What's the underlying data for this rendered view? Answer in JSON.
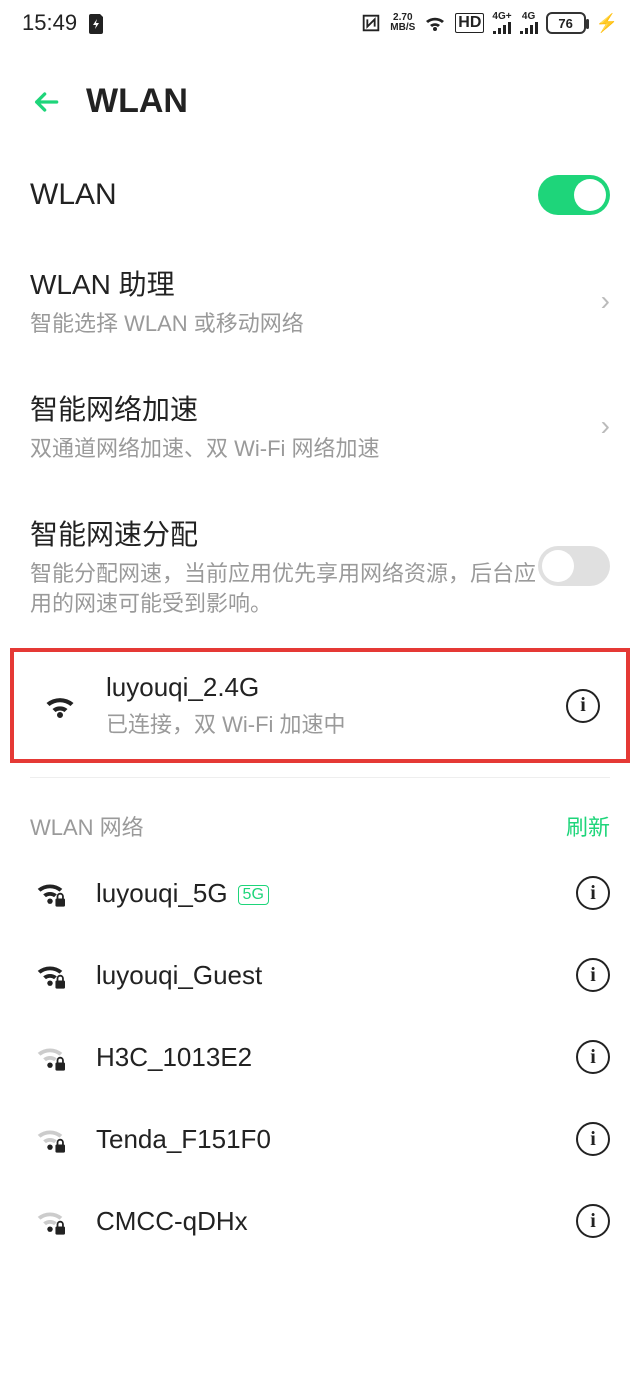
{
  "status": {
    "time": "15:49",
    "speed_top": "2.70",
    "speed_bot": "MB/S",
    "hd": "HD",
    "sig1_top": "4G+",
    "sig2_top": "4G",
    "battery": "76"
  },
  "header": {
    "title": "WLAN"
  },
  "wlan_toggle": {
    "label": "WLAN",
    "on": true
  },
  "items": [
    {
      "title": "WLAN 助理",
      "sub": "智能选择 WLAN 或移动网络",
      "type": "chev"
    },
    {
      "title": "智能网络加速",
      "sub": "双通道网络加速、双 Wi-Fi 网络加速",
      "type": "chev"
    },
    {
      "title": "智能网速分配",
      "sub": "智能分配网速，当前应用优先享用网络资源，后台应用的网速可能受到影响。",
      "type": "toggle_off"
    }
  ],
  "connected": {
    "name": "luyouqi_2.4G",
    "status": "已连接，双 Wi-Fi 加速中"
  },
  "listhdr": {
    "label": "WLAN 网络",
    "action": "刷新"
  },
  "networks": [
    {
      "name": "luyouqi_5G",
      "strength": "strong",
      "lock": true,
      "badge": "5G"
    },
    {
      "name": "luyouqi_Guest",
      "strength": "strong",
      "lock": true
    },
    {
      "name": "H3C_1013E2",
      "strength": "weak",
      "lock": true
    },
    {
      "name": "Tenda_F151F0",
      "strength": "weak",
      "lock": true
    },
    {
      "name": "CMCC-qDHx",
      "strength": "weak",
      "lock": true
    }
  ]
}
